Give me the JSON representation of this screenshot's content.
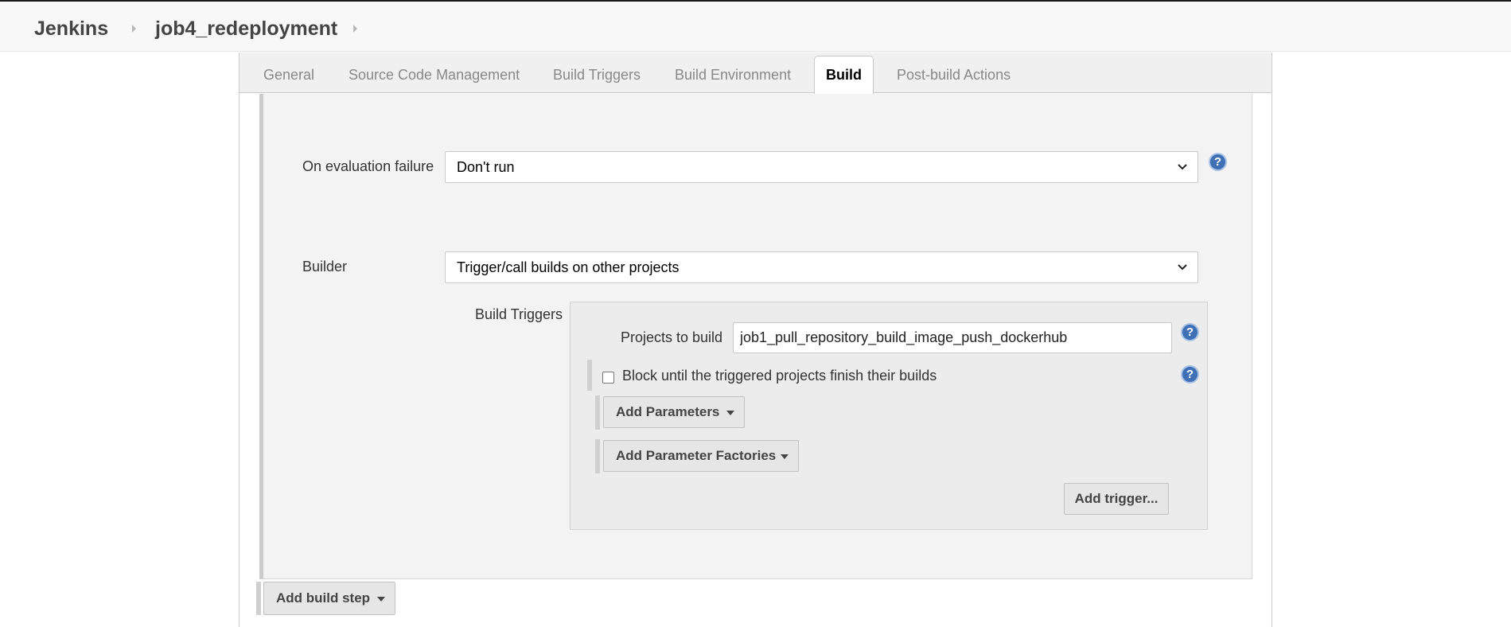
{
  "breadcrumb": {
    "items": [
      "Jenkins",
      "job4_redeployment"
    ]
  },
  "tabs": [
    {
      "label": "General"
    },
    {
      "label": "Source Code Management"
    },
    {
      "label": "Build Triggers"
    },
    {
      "label": "Build Environment"
    },
    {
      "label": "Build",
      "active": true
    },
    {
      "label": "Post-build Actions"
    }
  ],
  "build_step": {
    "on_evaluation_failure": {
      "label": "On evaluation failure",
      "value": "Don't run"
    },
    "builder": {
      "label": "Builder",
      "value": "Trigger/call builds on other projects"
    },
    "build_triggers": {
      "label": "Build Triggers",
      "projects_to_build": {
        "label": "Projects to build",
        "value": "job1_pull_repository_build_image_push_dockerhub"
      },
      "block_until_finish": {
        "label": "Block until the triggered projects finish their builds",
        "checked": false
      },
      "add_parameters_label": "Add Parameters",
      "add_parameter_factories_label": "Add Parameter Factories",
      "add_trigger_label": "Add trigger..."
    }
  },
  "add_build_step_label": "Add build step",
  "help_glyph": "?",
  "colors": {
    "help_icon": "#3f6fb4",
    "active_tab": "#000000",
    "inactive_tab": "#888888"
  }
}
